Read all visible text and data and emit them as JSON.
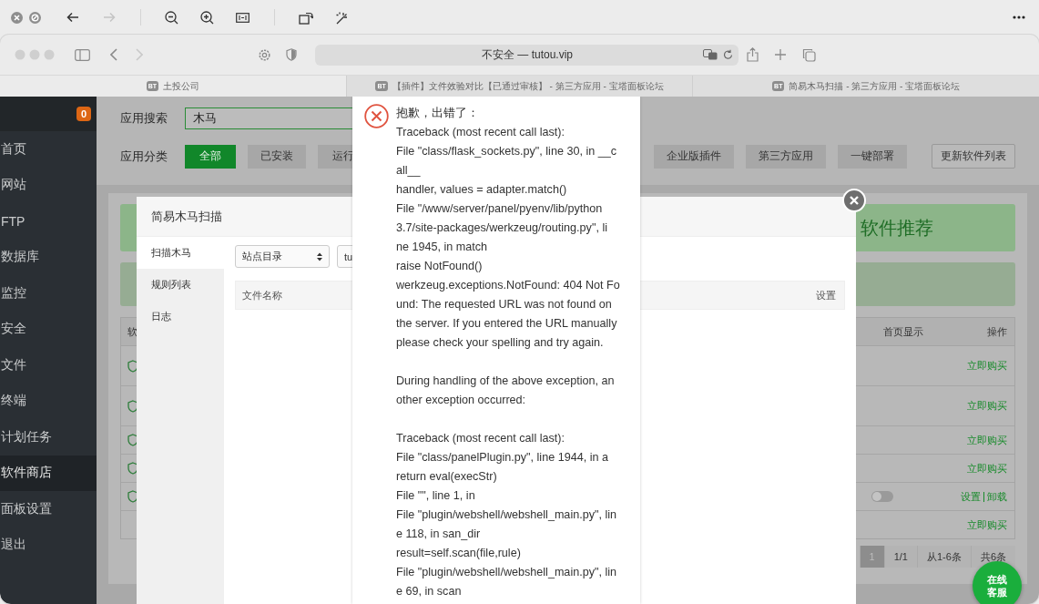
{
  "viewer_toolbar": {
    "nav": [
      {
        "kind": "back",
        "disabled": false
      },
      {
        "kind": "forward",
        "disabled": true
      }
    ]
  },
  "browser": {
    "nav": [
      {
        "kind": "back",
        "disabled": false
      },
      {
        "kind": "forward",
        "disabled": true
      }
    ],
    "address": "不安全 — tutou.vip",
    "tabs": [
      {
        "favicon": "BT",
        "title": "土投公司",
        "selected": true
      },
      {
        "favicon": "BT",
        "title": "【插件】文件效验对比【已通过审核】 - 第三方应用 - 宝塔面板论坛",
        "selected": false
      },
      {
        "favicon": "BT",
        "title": "简易木马扫描 - 第三方应用 - 宝塔面板论坛",
        "selected": false
      }
    ]
  },
  "sidebar": {
    "badge": "0",
    "items": [
      {
        "label": "首页",
        "selected": false
      },
      {
        "label": "网站",
        "selected": false
      },
      {
        "label": "FTP",
        "selected": false
      },
      {
        "label": "数据库",
        "selected": false
      },
      {
        "label": "监控",
        "selected": false
      },
      {
        "label": "安全",
        "selected": false
      },
      {
        "label": "文件",
        "selected": false
      },
      {
        "label": "终端",
        "selected": false
      },
      {
        "label": "计划任务",
        "selected": false
      },
      {
        "label": "软件商店",
        "selected": true
      },
      {
        "label": "面板设置",
        "selected": false
      },
      {
        "label": "退出",
        "selected": false
      }
    ]
  },
  "search": {
    "label": "应用搜索",
    "value": "木马"
  },
  "categories": {
    "label": "应用分类",
    "items": [
      {
        "label": "全部",
        "selected": true
      },
      {
        "label": "已安装",
        "selected": false
      },
      {
        "label": "运行",
        "selected": false
      }
    ],
    "more_items": [
      {
        "label": "企业版插件",
        "selected": false
      },
      {
        "label": "第三方应用",
        "selected": false
      },
      {
        "label": "一键部署",
        "selected": false
      }
    ]
  },
  "update_button": "更新软件列表",
  "banner": {
    "title": "软件推荐"
  },
  "table": {
    "columns": [
      "软",
      "首页显示",
      "操作"
    ],
    "rows": [
      {
        "kind": "buy",
        "actions": [
          "立即购买"
        ]
      },
      {
        "kind": "buy",
        "actions": [
          "立即购买"
        ]
      },
      {
        "kind": "buy",
        "actions": [
          "立即购买"
        ]
      },
      {
        "kind": "buy",
        "actions": [
          "立即购买"
        ]
      },
      {
        "kind": "installed",
        "home_display": false,
        "actions": [
          "设置",
          "卸载"
        ]
      },
      {
        "kind": "buy",
        "actions": [
          "立即购买"
        ]
      }
    ]
  },
  "pagination": {
    "pages": [
      {
        "label": "1",
        "selected": true
      }
    ],
    "info": [
      "1/1",
      "从1-6条",
      "共6条"
    ]
  },
  "dialog": {
    "title": "简易木马扫描",
    "tabs": [
      {
        "label": "扫描木马",
        "selected": true
      },
      {
        "label": "规则列表",
        "selected": false
      },
      {
        "label": "日志",
        "selected": false
      }
    ],
    "selects": [
      "站点目录",
      "tu"
    ],
    "columns": [
      "文件名称",
      "设置"
    ]
  },
  "error": {
    "title": "抱歉，出错了：",
    "paragraphs": [
      [
        "Traceback (most recent call last):",
        "File \"class/flask_sockets.py\", line 30, in __c",
        "all__",
        "handler, values = adapter.match()",
        "File \"/www/server/panel/pyenv/lib/python",
        "3.7/site-packages/werkzeug/routing.py\", li",
        "ne 1945, in match",
        "raise NotFound()",
        "werkzeug.exceptions.NotFound: 404 Not Fo",
        "und: The requested URL was not found on",
        "the server. If you entered the URL manually",
        "please check your spelling and try again."
      ],
      [
        "During handling of the above exception, an",
        "other exception occurred:"
      ],
      [
        "Traceback (most recent call last):",
        "File \"class/panelPlugin.py\", line 1944, in a",
        "return eval(execStr)",
        "File \"\", line 1, in",
        "File \"plugin/webshell/webshell_main.py\", lin",
        "e 118, in san_dir",
        "result=self.scan(file,rule)",
        "File \"plugin/webshell/webshell_main.py\", lin",
        "e 69, in scan"
      ]
    ]
  },
  "chat_button": "在线客服"
}
